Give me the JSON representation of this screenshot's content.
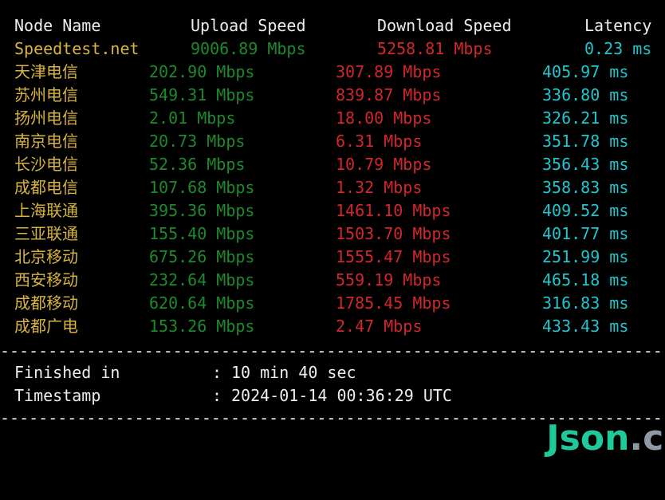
{
  "header": {
    "node": "Node Name",
    "upload": "Upload Speed",
    "download": "Download Speed",
    "latency": "Latency"
  },
  "rows": [
    {
      "node": "Speedtest.net",
      "upload": "9006.89 Mbps",
      "download": "5258.81 Mbps",
      "latency": "0.23 ms"
    },
    {
      "node": "天津电信",
      "upload": "202.90 Mbps",
      "download": "307.89 Mbps",
      "latency": "405.97 ms"
    },
    {
      "node": "苏州电信",
      "upload": "549.31 Mbps",
      "download": "839.87 Mbps",
      "latency": "336.80 ms"
    },
    {
      "node": "扬州电信",
      "upload": "2.01 Mbps",
      "download": "18.00 Mbps",
      "latency": "326.21 ms"
    },
    {
      "node": "南京电信",
      "upload": "20.73 Mbps",
      "download": "6.31 Mbps",
      "latency": "351.78 ms"
    },
    {
      "node": "长沙电信",
      "upload": "52.36 Mbps",
      "download": "10.79 Mbps",
      "latency": "356.43 ms"
    },
    {
      "node": "成都电信",
      "upload": "107.68 Mbps",
      "download": "1.32 Mbps",
      "latency": "358.83 ms"
    },
    {
      "node": "上海联通",
      "upload": "395.36 Mbps",
      "download": "1461.10 Mbps",
      "latency": "409.52 ms"
    },
    {
      "node": "三亚联通",
      "upload": "155.40 Mbps",
      "download": "1503.70 Mbps",
      "latency": "401.77 ms"
    },
    {
      "node": "北京移动",
      "upload": "675.26 Mbps",
      "download": "1555.47 Mbps",
      "latency": "251.99 ms"
    },
    {
      "node": "西安移动",
      "upload": "232.64 Mbps",
      "download": "559.19 Mbps",
      "latency": "465.18 ms"
    },
    {
      "node": "成都移动",
      "upload": "620.64 Mbps",
      "download": "1785.45 Mbps",
      "latency": "316.83 ms"
    },
    {
      "node": "成都广电",
      "upload": "153.26 Mbps",
      "download": "2.47 Mbps",
      "latency": "433.43 ms"
    }
  ],
  "divider": "----------------------------------------------------------------------",
  "summary": {
    "finished_label": "Finished in",
    "finished_value": "10 min 40 sec",
    "timestamp_label": "Timestamp",
    "timestamp_value": "2024-01-14 00:36:29 UTC",
    "separator": ":"
  },
  "watermark": {
    "part1": "Json",
    "part2": ".cn"
  },
  "colors": {
    "background": "#000000",
    "text": "#ededed",
    "node": "#d7b53f",
    "upload": "#1c8a2c",
    "download": "#d2262c",
    "latency": "#21c6cc"
  }
}
